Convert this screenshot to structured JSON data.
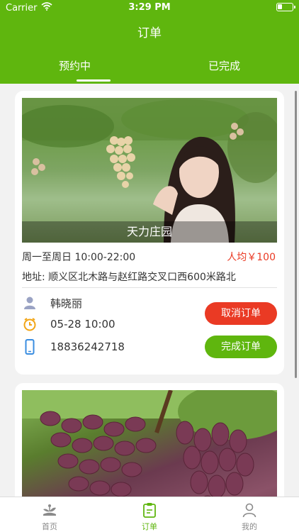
{
  "status_bar": {
    "carrier": "Carrier",
    "time": "3:29 PM"
  },
  "nav": {
    "title": "订单"
  },
  "tabs": [
    {
      "label": "预约中",
      "active": true
    },
    {
      "label": "已完成",
      "active": false
    }
  ],
  "orders": [
    {
      "image": "grape-vineyard-photo",
      "farm_name": "天力庄园",
      "hours": "周一至周日 10:00-22:00",
      "price": "人均￥100",
      "address": "地址:  顺义区北木路与赵红路交叉口西600米路北",
      "contact_name": "韩晓丽",
      "appointment_time": "05-28 10:00",
      "phone": "18836242718",
      "cancel_label": "取消订单",
      "complete_label": "完成订单"
    },
    {
      "image": "red-grapes-photo"
    }
  ],
  "tabbar": [
    {
      "label": "首页",
      "icon": "home-plant-icon",
      "active": false
    },
    {
      "label": "订单",
      "icon": "clipboard-icon",
      "active": true
    },
    {
      "label": "我的",
      "icon": "user-icon",
      "active": false
    }
  ],
  "colors": {
    "brand_green": "#5fb60e",
    "accent_red": "#ea3a24"
  }
}
